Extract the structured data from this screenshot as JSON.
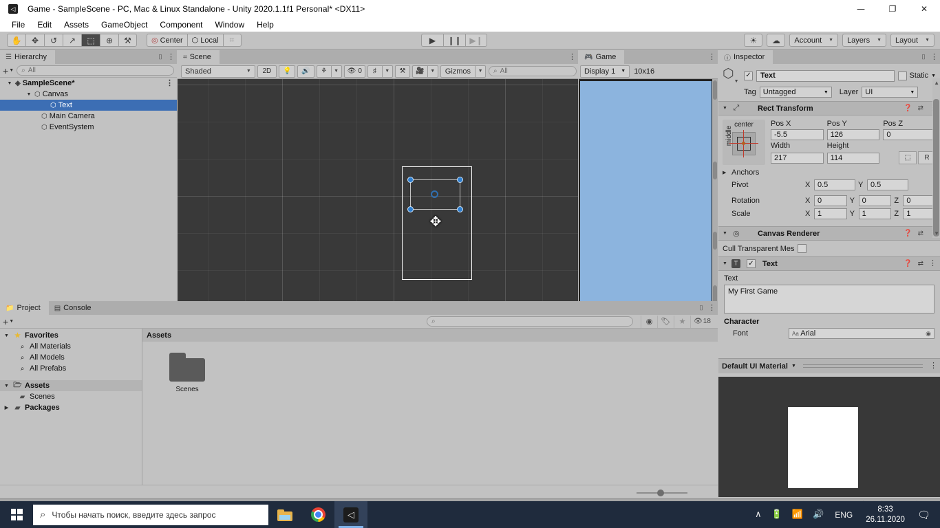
{
  "window": {
    "title": "Game - SampleScene - PC, Mac & Linux Standalone - Unity 2020.1.1f1 Personal* <DX11>",
    "app_icon": "unity-icon",
    "minimize": "—",
    "maximize": "❐",
    "close": "✕"
  },
  "menu": {
    "items": [
      "File",
      "Edit",
      "Assets",
      "GameObject",
      "Component",
      "Window",
      "Help"
    ]
  },
  "toolbar": {
    "tools": [
      {
        "name": "hand-tool",
        "glyph": "✋",
        "active": false
      },
      {
        "name": "move-tool",
        "glyph": "✥",
        "active": false
      },
      {
        "name": "rotate-tool",
        "glyph": "↺",
        "active": false
      },
      {
        "name": "scale-tool",
        "glyph": "↗",
        "active": false
      },
      {
        "name": "rect-tool",
        "glyph": "⬚",
        "active": true
      },
      {
        "name": "transform-tool",
        "glyph": "⊕",
        "active": false
      },
      {
        "name": "custom-editor-tool",
        "glyph": "⚒",
        "active": false
      }
    ],
    "pivot_mode": "Center",
    "pivot_rotation": "Local",
    "grid_snap_glyph": "⌗",
    "play": "▶",
    "pause": "❙❙",
    "step": "▶❙",
    "cloud_icon": "☁",
    "services_icon": "☀",
    "account": "Account",
    "layers": "Layers",
    "layout": "Layout"
  },
  "hierarchy": {
    "tab": "Hierarchy",
    "tab_icon": "hierarchy-icon",
    "search_placeholder": "All",
    "create_label": "+",
    "rows": [
      {
        "label": "SampleScene*",
        "depth": 0,
        "expanded": true,
        "selected": false,
        "bold": true,
        "icon": "unity-scene-icon"
      },
      {
        "label": "Canvas",
        "depth": 1,
        "expanded": true,
        "selected": false,
        "bold": false,
        "icon": "gameobject-icon"
      },
      {
        "label": "Text",
        "depth": 2,
        "expanded": false,
        "selected": true,
        "bold": false,
        "icon": "gameobject-icon"
      },
      {
        "label": "Main Camera",
        "depth": 1,
        "expanded": false,
        "selected": false,
        "bold": false,
        "icon": "gameobject-icon"
      },
      {
        "label": "EventSystem",
        "depth": 1,
        "expanded": false,
        "selected": false,
        "bold": false,
        "icon": "gameobject-icon"
      }
    ]
  },
  "scene": {
    "tab": "Scene",
    "tab_icon": "scene-icon",
    "draw_mode": "Shaded",
    "mode_2d": "2D",
    "lighting_icon": "☀",
    "audio_icon": "ὐA",
    "fx_icon": "☸",
    "hidden_count": "0",
    "grid_icon": "⌗",
    "gizmos_label": "Gizmos",
    "search_placeholder": "All"
  },
  "game": {
    "tab": "Game",
    "tab_icon": "game-icon",
    "display": "Display 1",
    "aspect": "10x16",
    "background_color": "#8cb4de"
  },
  "inspector": {
    "tab": "Inspector",
    "tab_icon": "inspector-icon",
    "object_name": "Text",
    "enabled": true,
    "static_label": "Static",
    "tag_label": "Tag",
    "tag_value": "Untagged",
    "layer_label": "Layer",
    "layer_value": "UI",
    "rect_transform": {
      "title": "Rect Transform",
      "anchor_top_label": "center",
      "anchor_left_label": "middle",
      "pos_x_label": "Pos X",
      "pos_y_label": "Pos Y",
      "pos_z_label": "Pos Z",
      "pos_x": "-5.5",
      "pos_y": "126",
      "pos_z": "0",
      "width_label": "Width",
      "height_label": "Height",
      "width": "217",
      "height": "114",
      "blueprint_glyph": "⬚",
      "raw_label": "R",
      "anchors_label": "Anchors",
      "pivot_label": "Pivot",
      "pivot_x": "0.5",
      "pivot_y": "0.5",
      "rotation_label": "Rotation",
      "rot_x": "0",
      "rot_y": "0",
      "rot_z": "0",
      "scale_label": "Scale",
      "scale_x": "1",
      "scale_y": "1",
      "scale_z": "1"
    },
    "canvas_renderer": {
      "title": "Canvas Renderer",
      "cull_label": "Cull Transparent Mes",
      "cull_checked": false
    },
    "text_component": {
      "title": "Text",
      "enabled": true,
      "text_label": "Text",
      "text_value": "My First Game",
      "character_label": "Character",
      "font_label": "Font",
      "font_value": "Arial"
    },
    "material": {
      "name": "Default UI Material"
    }
  },
  "project": {
    "tab": "Project",
    "tab_icon": "project-icon",
    "console_tab": "Console",
    "console_icon": "console-icon",
    "search_placeholder": "",
    "visible_count": "18",
    "tree": [
      {
        "label": "Favorites",
        "depth": 0,
        "tri": "▼",
        "icon": "★",
        "icon_color": "#e8b92e",
        "bold": true,
        "hl": false
      },
      {
        "label": "All Materials",
        "depth": 1,
        "tri": "",
        "icon": "⌕",
        "icon_color": "#4a4a4a",
        "bold": false,
        "hl": false
      },
      {
        "label": "All Models",
        "depth": 1,
        "tri": "",
        "icon": "⌕",
        "icon_color": "#4a4a4a",
        "bold": false,
        "hl": false
      },
      {
        "label": "All Prefabs",
        "depth": 1,
        "tri": "",
        "icon": "⌕",
        "icon_color": "#4a4a4a",
        "bold": false,
        "hl": false
      },
      {
        "label": "Assets",
        "depth": 0,
        "tri": "▼",
        "icon": "὜1",
        "icon_color": "#555",
        "bold": true,
        "hl": true
      },
      {
        "label": "Scenes",
        "depth": 1,
        "tri": "",
        "icon": "▰",
        "icon_color": "#555",
        "bold": false,
        "hl": false
      },
      {
        "label": "Packages",
        "depth": 0,
        "tri": "▶",
        "icon": "▰",
        "icon_color": "#555",
        "bold": true,
        "hl": false
      }
    ],
    "breadcrumb": "Assets",
    "assets": [
      {
        "name": "Scenes",
        "type": "folder"
      }
    ]
  },
  "statusbar": {
    "icons": [
      {
        "name": "collab-muted-icon",
        "glyph": "⚡"
      },
      {
        "name": "layers-icon",
        "glyph": "≡"
      },
      {
        "name": "no-sound-icon",
        "glyph": "⊘"
      },
      {
        "name": "check-icon",
        "glyph": "✓"
      }
    ]
  },
  "taskbar": {
    "search_placeholder": "Чтобы начать поиск, введите здесь запрос",
    "apps": [
      {
        "name": "file-explorer",
        "active": false
      },
      {
        "name": "google-chrome",
        "active": false
      },
      {
        "name": "unity-editor",
        "active": true
      }
    ],
    "tray": {
      "chevron": "∧",
      "battery": "ὐB",
      "wifi": "὏6",
      "volume": "ὐA",
      "language": "ENG",
      "time": "8:33",
      "date": "26.11.2020",
      "action_center": "὞8"
    }
  }
}
